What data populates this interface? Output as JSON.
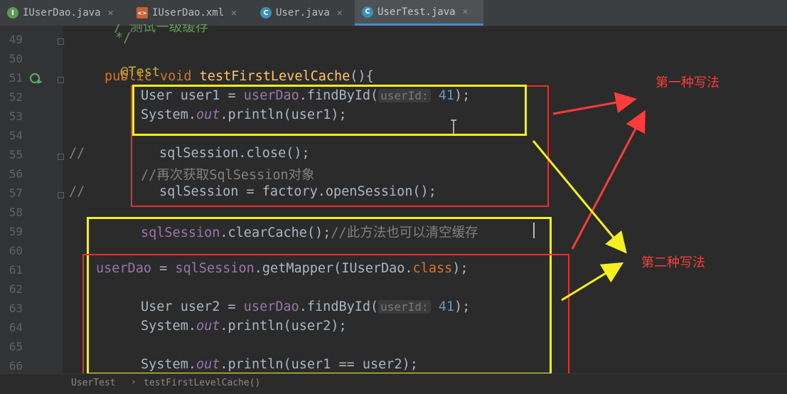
{
  "tabs": [
    {
      "label": "IUserDao.java",
      "icon": "interface-icon",
      "glyph": "I"
    },
    {
      "label": "IUserDao.xml",
      "icon": "xml-file-icon",
      "glyph": "<>"
    },
    {
      "label": "User.java",
      "icon": "class-icon",
      "glyph": "C"
    },
    {
      "label": "UserTest.java",
      "icon": "class-icon",
      "glyph": "C",
      "active": true
    }
  ],
  "close_glyph": "✕",
  "line_numbers": [
    "49",
    "50",
    "51",
    "52",
    "53",
    "54",
    "55",
    "56",
    "57",
    "58",
    "59",
    "60",
    "61",
    "62",
    "63",
    "64",
    "65",
    "66"
  ],
  "code": {
    "l48_partial": "/ 测试一级缓存",
    "l49": "*/",
    "l50": "@Test",
    "l51_public": "public",
    "l51_void": "void",
    "l51_name": "testFirstLevelCache",
    "l51_rest": "(){",
    "l52_a": "User user1 = ",
    "l52_b": "userDao",
    "l52_c": ".findById(",
    "l52_hint": "userId:",
    "l52_num": "41",
    "l52_d": ");",
    "l53_a": "System.",
    "l53_b": "out",
    "l53_c": ".println(user1);",
    "l55_prefix": "//",
    "l55": "sqlSession.close();",
    "l56": "//再次获取SqlSession对象",
    "l57_prefix": "//",
    "l57": "sqlSession = factory.openSession();",
    "l59_a": "sqlSession",
    "l59_b": ".clearCache();",
    "l59_c": "//此方法也可以清空缓存",
    "l61_a": "userDao",
    "l61_b": " = ",
    "l61_c": "sqlSession",
    "l61_d": ".getMapper(IUserDao.",
    "l61_e": "class",
    "l61_f": ");",
    "l63_a": "User user2 = ",
    "l63_b": "userDao",
    "l63_c": ".findById(",
    "l63_hint": "userId:",
    "l63_num": "41",
    "l63_d": ");",
    "l64_a": "System.",
    "l64_b": "out",
    "l64_c": ".println(user2);",
    "l66_a": "System.",
    "l66_b": "out",
    "l66_c": ".println(user1 == user2);"
  },
  "annotations": {
    "method1": "第一种写法",
    "method2": "第二种写法"
  },
  "breadcrumb": {
    "class": "UserTest",
    "sep": "›",
    "method": "testFirstLevelCache()"
  },
  "colors": {
    "red_box": "#e8302f",
    "yellow_box": "#f5f01e",
    "red_arrow": "#ff3b3b",
    "yellow_arrow": "#f5f01e"
  }
}
